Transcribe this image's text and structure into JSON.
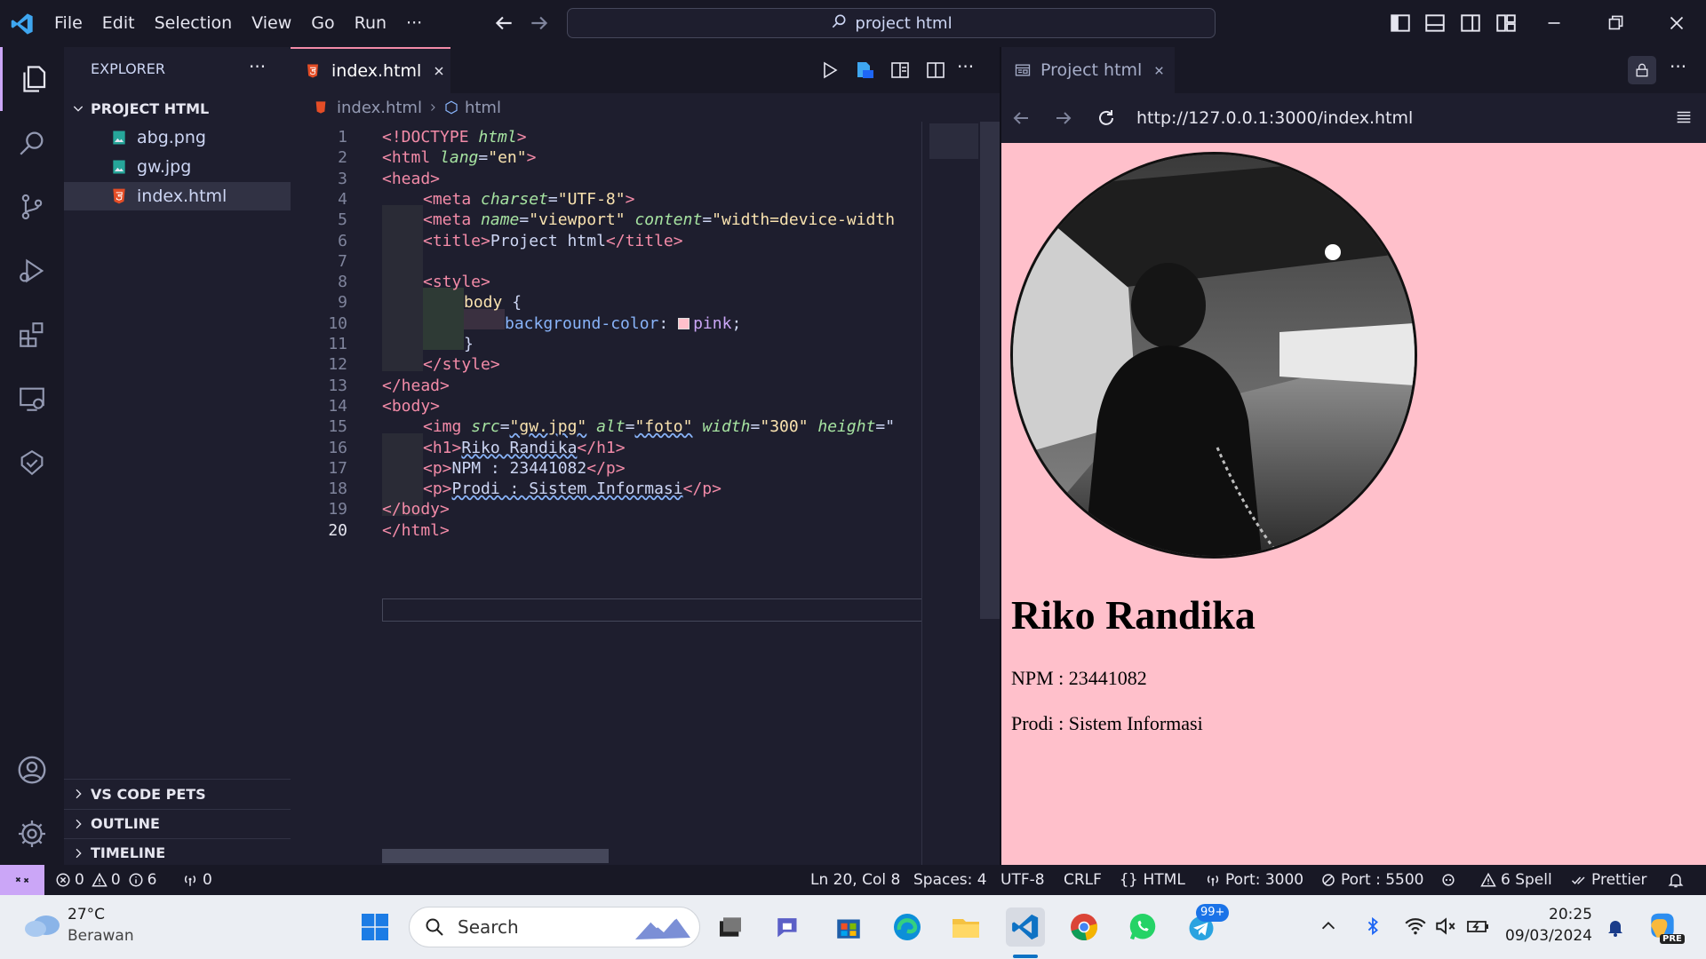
{
  "titlebar": {
    "menu": [
      "File",
      "Edit",
      "Selection",
      "View",
      "Go",
      "Run",
      "···"
    ],
    "search_text": "project html"
  },
  "sidebar": {
    "title": "EXPLORER",
    "more": "···",
    "project": "PROJECT HTML",
    "files": [
      "abg.png",
      "gw.jpg",
      "index.html"
    ],
    "sections": [
      "VS CODE PETS",
      "OUTLINE",
      "TIMELINE"
    ]
  },
  "editor": {
    "tab_label": "index.html",
    "breadcrumb_file": "index.html",
    "breadcrumb_node": "html",
    "line_numbers": [
      "1",
      "2",
      "3",
      "4",
      "5",
      "6",
      "7",
      "8",
      "9",
      "10",
      "11",
      "12",
      "13",
      "14",
      "15",
      "16",
      "17",
      "18",
      "19",
      "20"
    ],
    "code": {
      "l1": [
        "<!DOCTYPE ",
        "html",
        ">"
      ],
      "l2": [
        "<html ",
        "lang",
        "=",
        "\"en\"",
        ">"
      ],
      "l3": [
        "<head>"
      ],
      "l4": [
        "<meta ",
        "charset",
        "=",
        "\"UTF-8\"",
        ">"
      ],
      "l5": [
        "<meta ",
        "name",
        "=",
        "\"viewport\"",
        "",
        " content",
        "=",
        "\"width=device-width"
      ],
      "l6": [
        "<title>",
        "Project html",
        "</title>"
      ],
      "l8": [
        "<style>"
      ],
      "l9": [
        "body",
        " {"
      ],
      "l10": [
        "background-color",
        ": ",
        "pink",
        ";"
      ],
      "l11": [
        "}"
      ],
      "l12": [
        "</style>"
      ],
      "l13": [
        "</head>"
      ],
      "l14": [
        "<body>"
      ],
      "l15": [
        "<img ",
        "src",
        "=",
        "\"gw.jpg\"",
        " alt",
        "=",
        "\"foto\"",
        " width",
        "=",
        "\"300\"",
        " height",
        "=\""
      ],
      "l16": [
        "<h1>",
        "Riko Randika",
        "</h1>"
      ],
      "l17": [
        "<p>",
        "NPM : 23441082",
        "</p>"
      ],
      "l18": [
        "<p>",
        "Prodi : Sistem Informasi",
        "</p>"
      ],
      "l19": [
        "</body>"
      ],
      "l20": [
        "</html>"
      ]
    }
  },
  "preview": {
    "tab_label": "Project html",
    "url": "http://127.0.0.1:3000/index.html",
    "name": "Riko Randika",
    "npm": "NPM : 23441082",
    "prodi": "Prodi : Sistem Informasi",
    "background": "#ffc0cb"
  },
  "statusbar": {
    "errors": "0",
    "warnings": "0",
    "infos": "6",
    "ports": "0",
    "position": "Ln 20, Col 8",
    "spaces": "Spaces: 4",
    "encoding": "UTF-8",
    "eol": "CRLF",
    "language": "HTML",
    "port_live": "Port: 3000",
    "port_off": "Port : 5500",
    "spell": "6 Spell",
    "prettier": "Prettier"
  },
  "taskbar": {
    "weather_temp": "27°C",
    "weather_desc": "Berawan",
    "search": "Search",
    "badge": "99+",
    "time": "20:25",
    "date": "09/03/2024",
    "pre_badge": "PRE"
  },
  "colors": {
    "accent": "#cba6f7",
    "tab_border": "#f38ba8",
    "html_icon": "#e44d26",
    "preview_bg": "#ffc0cb"
  }
}
